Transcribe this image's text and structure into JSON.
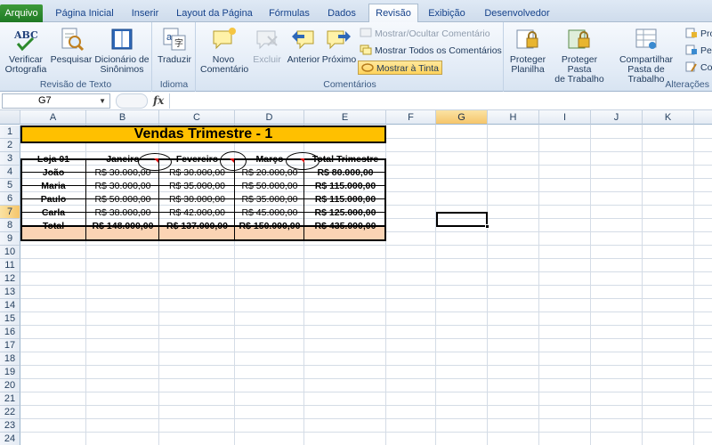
{
  "tabs": [
    {
      "id": "arquivo",
      "label": "Arquivo"
    },
    {
      "id": "inicial",
      "label": "Página Inicial"
    },
    {
      "id": "inserir",
      "label": "Inserir"
    },
    {
      "id": "layout",
      "label": "Layout da Página"
    },
    {
      "id": "formulas",
      "label": "Fórmulas"
    },
    {
      "id": "dados",
      "label": "Dados"
    },
    {
      "id": "revisao",
      "label": "Revisão"
    },
    {
      "id": "exibicao",
      "label": "Exibição"
    },
    {
      "id": "desenvolvedor",
      "label": "Desenvolvedor"
    }
  ],
  "active_tab": "Revisão",
  "ribbon": {
    "revisao_texto": {
      "label": "Revisão de Texto",
      "verificar": "Verificar\nOrtografia",
      "pesquisar": "Pesquisar",
      "dicionario": "Dicionário de\nSinônimos"
    },
    "idioma": {
      "label": "Idioma",
      "traduzir": "Traduzir"
    },
    "comentarios": {
      "label": "Comentários",
      "novo": "Novo\nComentário",
      "excluir": "Excluir",
      "anterior": "Anterior",
      "proximo": "Próximo",
      "mostrar_ocultar": "Mostrar/Ocultar Comentário",
      "mostrar_todos": "Mostrar Todos os Comentários",
      "mostrar_tinta": "Mostrar à Tinta"
    },
    "alteracoes": {
      "label": "Alterações",
      "proteger_planilha": "Proteger\nPlanilha",
      "proteger_pasta": "Proteger Pasta\nde Trabalho",
      "compartilhar": "Compartilhar\nPasta de Trabalho",
      "pro": "Pro",
      "pe": "Pe",
      "co": "Co"
    }
  },
  "formula_bar": {
    "name_box": "G7",
    "fx": "fx",
    "value": ""
  },
  "columns": [
    "A",
    "B",
    "C",
    "D",
    "E",
    "F",
    "G",
    "H",
    "I",
    "J",
    "K",
    "L"
  ],
  "selected_column": "G",
  "rows": [
    "1",
    "2",
    "3",
    "4",
    "5",
    "6",
    "7",
    "8",
    "9",
    "10",
    "11",
    "12",
    "13",
    "14",
    "15",
    "16",
    "17",
    "18",
    "19",
    "20",
    "21",
    "22",
    "23",
    "24"
  ],
  "selected_row": "7",
  "sheet": {
    "title": "Vendas Trimestre - 1",
    "headers": [
      "Loja 01",
      "Janeiro",
      "Fevereiro",
      "Março",
      "Total Trimestre"
    ],
    "data": [
      [
        "João",
        "R$ 30.000,00",
        "R$ 30.000,00",
        "R$ 20.000,00",
        "R$ 80.000,00"
      ],
      [
        "Maria",
        "R$ 30.000,00",
        "R$ 35.000,00",
        "R$ 50.000,00",
        "R$ 115.000,00"
      ],
      [
        "Paulo",
        "R$ 50.000,00",
        "R$ 30.000,00",
        "R$ 35.000,00",
        "R$ 115.000,00"
      ],
      [
        "Carla",
        "R$ 38.000,00",
        "R$ 42.000,00",
        "R$ 45.000,00",
        "R$ 125.000,00"
      ]
    ],
    "total": [
      "Total",
      "R$ 148.000,00",
      "R$ 137.000,00",
      "R$ 150.000,00",
      "R$ 435.000,00"
    ]
  },
  "colors": {
    "title_fill": "#ffc000",
    "total_fill": "#fbd4b4",
    "comment_marker": "#e01010",
    "file_tab": "#2a8a2e"
  }
}
